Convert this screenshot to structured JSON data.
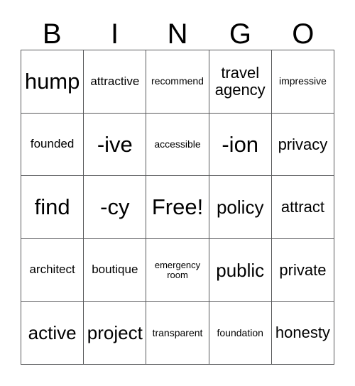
{
  "card": {
    "type": "bingo-card",
    "columns": 5,
    "rows": 5,
    "header_letters": [
      "B",
      "I",
      "N",
      "G",
      "O"
    ],
    "border_color": "#58595b",
    "background_color": "#ffffff",
    "text_color": "#000000",
    "free_space": {
      "row": 2,
      "column": 2,
      "label": "Free!"
    },
    "grid": [
      [
        {
          "text": "hump",
          "size": "xl"
        },
        {
          "text": "attractive",
          "size": "sm"
        },
        {
          "text": "recommend",
          "size": "xs"
        },
        {
          "text": "travel agency",
          "size": "md"
        },
        {
          "text": "impressive",
          "size": "xs"
        }
      ],
      [
        {
          "text": "founded",
          "size": "sm"
        },
        {
          "text": "-ive",
          "size": "xl"
        },
        {
          "text": "accessible",
          "size": "xs"
        },
        {
          "text": "-ion",
          "size": "xl"
        },
        {
          "text": "privacy",
          "size": "md"
        }
      ],
      [
        {
          "text": "find",
          "size": "xl"
        },
        {
          "text": "-cy",
          "size": "xl"
        },
        {
          "text": "Free!",
          "size": "xl"
        },
        {
          "text": "policy",
          "size": "lg"
        },
        {
          "text": "attract",
          "size": "md"
        }
      ],
      [
        {
          "text": "architect",
          "size": "sm"
        },
        {
          "text": "boutique",
          "size": "sm"
        },
        {
          "text": "emergency room",
          "size": "xxs"
        },
        {
          "text": "public",
          "size": "lg"
        },
        {
          "text": "private",
          "size": "md"
        }
      ],
      [
        {
          "text": "active",
          "size": "lg"
        },
        {
          "text": "project",
          "size": "lg"
        },
        {
          "text": "transparent",
          "size": "xs"
        },
        {
          "text": "foundation",
          "size": "xs"
        },
        {
          "text": "honesty",
          "size": "md"
        }
      ]
    ]
  }
}
